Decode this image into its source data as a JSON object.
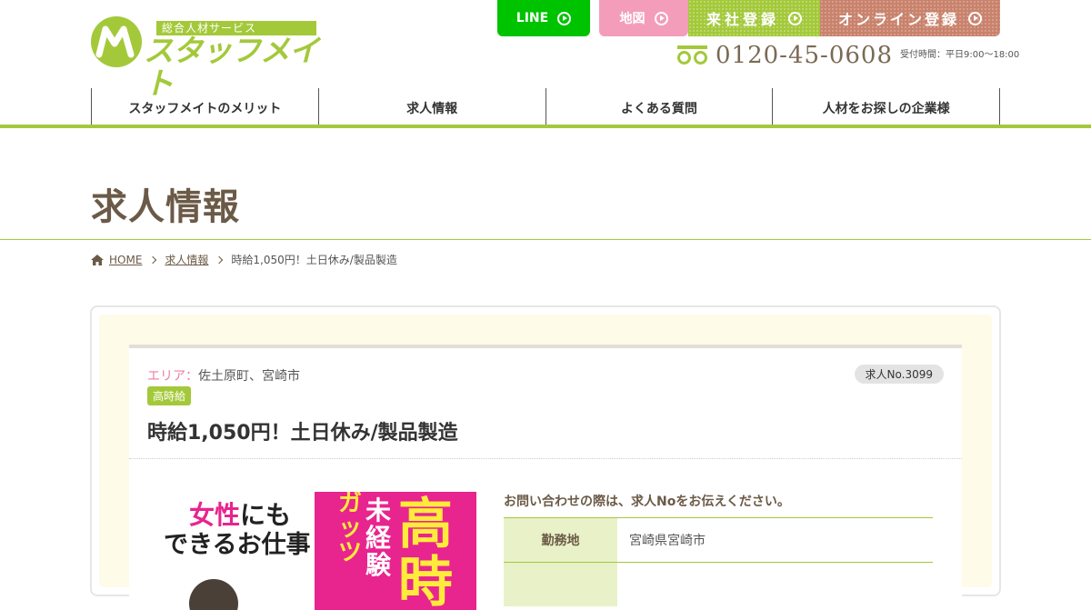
{
  "header": {
    "logo_tagline": "総合人材サービス",
    "logo_name": "スタッフメイト",
    "top_buttons": {
      "line": "LINE",
      "map": "地図",
      "visit": "来社登録",
      "online": "オンライン登録"
    },
    "phone_number": "0120-45-0608",
    "phone_hours": "受付時間：平日9:00～18:00"
  },
  "nav": {
    "items": [
      {
        "label": "スタッフメイトのメリット"
      },
      {
        "label": "求人情報"
      },
      {
        "label": "よくある質問"
      },
      {
        "label": "人材をお探しの企業様"
      }
    ]
  },
  "page_title": "求人情報",
  "breadcrumb": {
    "home": "HOME",
    "jobs": "求人情報",
    "current": "時給1,050円！土日休み/製品製造"
  },
  "job": {
    "area_label": "エリア：",
    "area_value": "佐土原町、宮崎市",
    "job_number": "求人No.3099",
    "badge": "高時給",
    "title": "時給1,050円！土日休み/製品製造",
    "ad_image": {
      "line1_pink": "女性",
      "line1_rest": "にも",
      "line2": "できるお仕事",
      "vertical1": "ガッツ",
      "vertical2": "未経験",
      "big": "高時"
    },
    "info_note": "お問い合わせの際は、求人Noをお伝えください。",
    "info_rows": [
      {
        "label": "勤務地",
        "value": "宮崎県宮崎市"
      },
      {
        "label": "",
        "value": ""
      }
    ]
  },
  "colors": {
    "brand_green": "#a3c93a",
    "line_green": "#00c300",
    "pink": "#f39dbb",
    "brown": "#6b5a47",
    "online_brown": "#c9826c"
  }
}
